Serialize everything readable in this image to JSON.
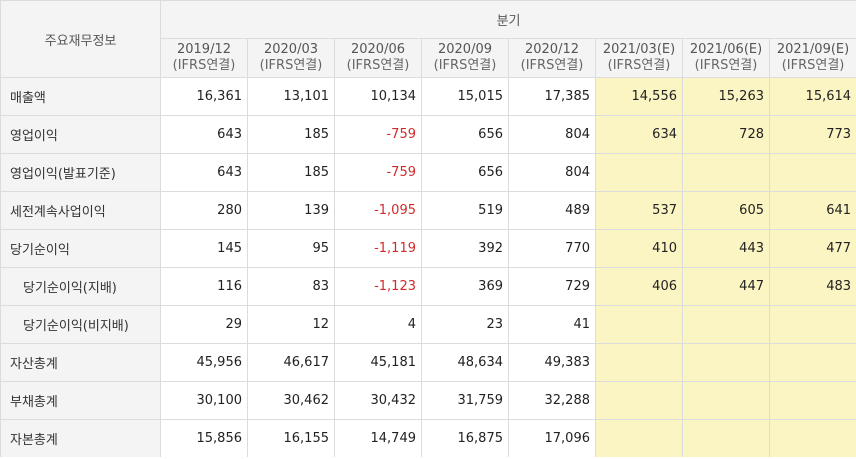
{
  "table": {
    "corner_label": "주요재무정보",
    "group_label": "분기",
    "periods": [
      {
        "period": "2019/12",
        "basis": "(IFRS연결)",
        "estimate": false
      },
      {
        "period": "2020/03",
        "basis": "(IFRS연결)",
        "estimate": false
      },
      {
        "period": "2020/06",
        "basis": "(IFRS연결)",
        "estimate": false
      },
      {
        "period": "2020/09",
        "basis": "(IFRS연결)",
        "estimate": false
      },
      {
        "period": "2020/12",
        "basis": "(IFRS연결)",
        "estimate": false
      },
      {
        "period": "2021/03(E)",
        "basis": "(IFRS연결)",
        "estimate": true
      },
      {
        "period": "2021/06(E)",
        "basis": "(IFRS연결)",
        "estimate": true
      },
      {
        "period": "2021/09(E)",
        "basis": "(IFRS연결)",
        "estimate": true
      }
    ],
    "rows": [
      {
        "label": "매출액",
        "indent": false,
        "values": [
          "16,361",
          "13,101",
          "10,134",
          "15,015",
          "17,385",
          "14,556",
          "15,263",
          "15,614"
        ]
      },
      {
        "label": "영업이익",
        "indent": false,
        "values": [
          "643",
          "185",
          "-759",
          "656",
          "804",
          "634",
          "728",
          "773"
        ]
      },
      {
        "label": "영업이익(발표기준)",
        "indent": false,
        "values": [
          "643",
          "185",
          "-759",
          "656",
          "804",
          "",
          "",
          ""
        ]
      },
      {
        "label": "세전계속사업이익",
        "indent": false,
        "values": [
          "280",
          "139",
          "-1,095",
          "519",
          "489",
          "537",
          "605",
          "641"
        ]
      },
      {
        "label": "당기순이익",
        "indent": false,
        "values": [
          "145",
          "95",
          "-1,119",
          "392",
          "770",
          "410",
          "443",
          "477"
        ]
      },
      {
        "label": "당기순이익(지배)",
        "indent": true,
        "values": [
          "116",
          "83",
          "-1,123",
          "369",
          "729",
          "406",
          "447",
          "483"
        ]
      },
      {
        "label": "당기순이익(비지배)",
        "indent": true,
        "values": [
          "29",
          "12",
          "4",
          "23",
          "41",
          "",
          "",
          ""
        ]
      },
      {
        "label": "자산총계",
        "indent": false,
        "values": [
          "45,956",
          "46,617",
          "45,181",
          "48,634",
          "49,383",
          "",
          "",
          ""
        ]
      },
      {
        "label": "부채총계",
        "indent": false,
        "values": [
          "30,100",
          "30,462",
          "30,432",
          "31,759",
          "32,288",
          "",
          "",
          ""
        ]
      },
      {
        "label": "자본총계",
        "indent": false,
        "values": [
          "15,856",
          "16,155",
          "14,749",
          "16,875",
          "17,096",
          "",
          "",
          ""
        ]
      }
    ],
    "colors": {
      "header_bg": "#f4f4f4",
      "estimate_bg": "#faf5c2",
      "negative_text": "#d12a2a",
      "border": "#dcdcdc"
    }
  }
}
